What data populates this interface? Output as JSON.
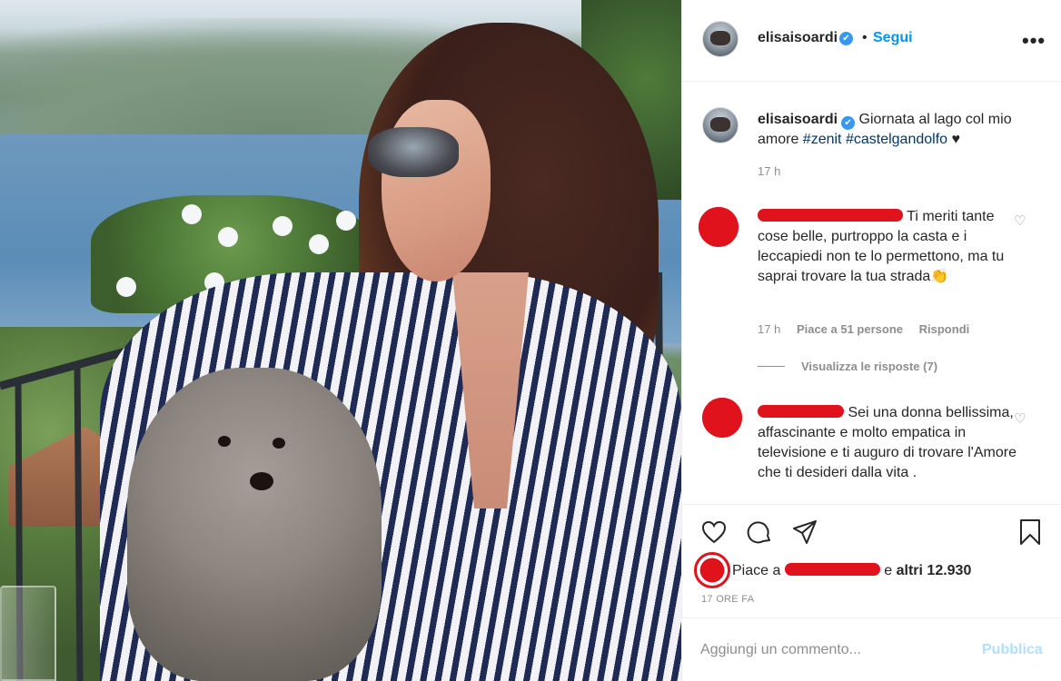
{
  "post": {
    "author": "elisaisoardi",
    "verified_mark": "✔",
    "dot": "•",
    "follow_label": "Segui",
    "more_label": "•••",
    "caption": {
      "username": "elisaisoardi",
      "text_before": "Giornata al lago col mio amore ",
      "hashtag_1": "#zenit",
      "hashtag_2": "#castelgandolfo",
      "text_after": " ♥",
      "time": "17 h"
    }
  },
  "comments": [
    {
      "text": "Ti meriti tante cose belle, purtroppo la casta e i leccapiedi non te lo permettono, ma tu saprai trovare la tua strada👏",
      "time": "17 h",
      "likes": "Piace a 51 persone",
      "reply_label": "Rispondi",
      "view_replies": "Visualizza le risposte (7)"
    },
    {
      "text": "Sei una donna bellissima, affascinante e molto empatica in televisione e ti auguro di trovare l'Amore che ti desideri dalla vita ."
    }
  ],
  "actions": {
    "likes_prefix": "Piace a",
    "likes_mid": " e ",
    "likes_rest": "altri 12.930",
    "posted_ago": "17 ORE FA"
  },
  "add_comment": {
    "placeholder": "Aggiungi un commento...",
    "publish_label": "Pubblica"
  },
  "colors": {
    "accent": "#0095f6",
    "redaction": "#e0121c",
    "verified": "#3897f0"
  }
}
